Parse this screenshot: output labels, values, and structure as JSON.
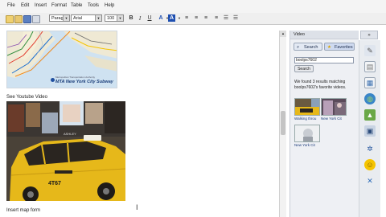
{
  "menu": {
    "items": [
      "File",
      "Edit",
      "Insert",
      "Format",
      "Table",
      "Tools",
      "Help"
    ]
  },
  "toolbar": {
    "paragraph_value": "Parag",
    "font_value": "Arial",
    "size_value": "100"
  },
  "editor": {
    "map_caption": "MTA New York City Subway",
    "map_small_text": "Metropolitan Transportation Authority",
    "video_heading": "See Youtube Video",
    "video_sign_text": "ASHLEY",
    "taxi_number": "4T67",
    "insert_map_heading": "Insert map form"
  },
  "panel": {
    "title": "Video",
    "search_tab": "Search",
    "favorites_tab": "Favorites",
    "search_value": "boolps7602",
    "search_button": "Search",
    "results_text": "We found 3 results matching boolps7602's favorite videos.",
    "results": [
      {
        "label": "Walking throu"
      },
      {
        "label": "New York Cit"
      },
      {
        "label": "New York Cit"
      }
    ]
  },
  "rail": {
    "collapse_label": "»",
    "icons": [
      "pen-icon",
      "document-icon",
      "calendar-icon",
      "globe-icon",
      "image-icon",
      "film-icon",
      "settings-icon",
      "smiley-icon",
      "sigma-icon"
    ]
  }
}
